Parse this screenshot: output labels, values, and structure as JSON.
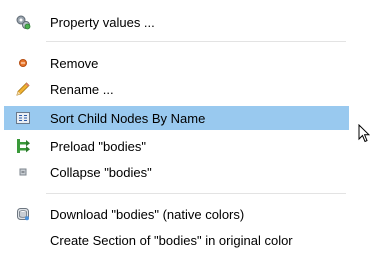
{
  "menu": {
    "items": [
      {
        "label": "Property values ...",
        "icon": "property-gears-icon"
      },
      {
        "label": "Remove",
        "icon": "remove-dot-icon"
      },
      {
        "label": "Rename ...",
        "icon": "pencil-icon"
      },
      {
        "label": "Sort Child Nodes By Name",
        "icon": "sort-az-icon",
        "highlighted": true
      },
      {
        "label": "Preload \"bodies\"",
        "icon": "preload-tree-icon"
      },
      {
        "label": "Collapse \"bodies\"",
        "icon": "collapse-square-icon"
      },
      {
        "label": "Download \"bodies\" (native colors)",
        "icon": "download-cylinder-icon"
      },
      {
        "label": "Create Section of \"bodies\" in original color",
        "icon": ""
      }
    ]
  },
  "colors": {
    "highlight": "#99c9ef",
    "separator": "#e3e3e3",
    "remove_dot": "#e8762c",
    "pencil": "#e0a526",
    "preload_green": "#3a9a3a"
  }
}
